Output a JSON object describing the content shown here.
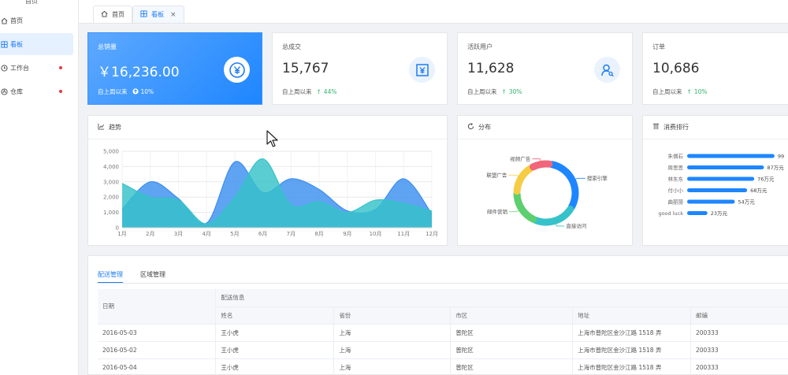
{
  "sidebar": {
    "top_label": "首页",
    "items": [
      {
        "label": "首页",
        "icon": "home-icon",
        "active": false,
        "dot": false
      },
      {
        "label": "看板",
        "icon": "grid-icon",
        "active": true,
        "dot": false
      },
      {
        "label": "工作台",
        "icon": "clock-icon",
        "active": false,
        "dot": true
      },
      {
        "label": "仓库",
        "icon": "box-icon",
        "active": false,
        "dot": true
      }
    ]
  },
  "tabs": [
    {
      "label": "首页",
      "icon": "home-icon",
      "active": false
    },
    {
      "label": "看板",
      "icon": "grid-icon",
      "active": true,
      "close": "×"
    }
  ],
  "stats": [
    {
      "title": "总销量",
      "value": "￥16,236.00",
      "foot": "自上周以来",
      "pct": "10%",
      "icon": "yen-coin-icon",
      "primary": true
    },
    {
      "title": "总成交",
      "value": "15,767",
      "foot": "自上周以来",
      "pct": "44%",
      "icon": "yen-bill-icon",
      "primary": false
    },
    {
      "title": "活跃用户",
      "value": "11,628",
      "foot": "自上周以来",
      "pct": "30%",
      "icon": "user-search-icon",
      "primary": false
    },
    {
      "title": "订单",
      "value": "10,686",
      "foot": "自上周以来",
      "pct": "10%",
      "icon": "order-icon",
      "primary": false
    }
  ],
  "panels": {
    "trend": "趋势",
    "distribution": "分布",
    "ranking": "消费排行"
  },
  "colors": {
    "primary": "#1e86ff",
    "teal": "#3cc4c4",
    "up": "#2fb56a"
  },
  "chart_data": [
    {
      "type": "area",
      "categories": [
        "1月",
        "2月",
        "3月",
        "4月",
        "5月",
        "6月",
        "7月",
        "8月",
        "9月",
        "10月",
        "11月",
        "12月"
      ],
      "ylim": [
        0,
        5000
      ],
      "yticks": [
        "0",
        "1,000",
        "2,000",
        "3,000",
        "4,000",
        "5,000"
      ],
      "grid": true,
      "series": [
        {
          "values": [
            1200,
            3000,
            1900,
            300,
            4300,
            2300,
            3200,
            2500,
            1100,
            1200,
            3200,
            900
          ],
          "color": "#3c8ff0"
        },
        {
          "values": [
            2900,
            2000,
            1800,
            250,
            2000,
            4500,
            1500,
            1700,
            1000,
            1800,
            1600,
            1100
          ],
          "color": "#36c2c9"
        }
      ]
    },
    {
      "type": "pie",
      "donut": true,
      "slices": [
        {
          "name": "搜索引擎",
          "value": 30,
          "color": "#1e86ff"
        },
        {
          "name": "直接访问",
          "value": 22,
          "color": "#36c2c9"
        },
        {
          "name": "邮件营销",
          "value": 18,
          "color": "#5ccf6e"
        },
        {
          "name": "联盟广告",
          "value": 16,
          "color": "#f5cd45"
        },
        {
          "name": "视频广告",
          "value": 10,
          "color": "#f0667a"
        }
      ]
    },
    {
      "type": "bar",
      "orientation": "horizontal",
      "xlim": [
        0,
        100
      ],
      "categories": [
        "朱偶石",
        "周思思",
        "林东东",
        "付小小",
        "曲丽丽",
        "good luck"
      ],
      "values": [
        99,
        87,
        76,
        68,
        54,
        23
      ],
      "labels": [
        "99",
        "87万元",
        "76万元",
        "68万元",
        "54万元",
        "23万元"
      ],
      "color": "#1e86ff"
    }
  ],
  "table": {
    "tabs": [
      "配送管理",
      "区域管理"
    ],
    "date_header": "日期",
    "group_header": "配送信息",
    "columns": [
      "姓名",
      "省份",
      "市区",
      "地址",
      "邮编"
    ],
    "rows": [
      [
        "2016-05-03",
        "王小虎",
        "上海",
        "普陀区",
        "上海市普陀区金沙江路 1518 弄",
        "200333"
      ],
      [
        "2016-05-02",
        "王小虎",
        "上海",
        "普陀区",
        "上海市普陀区金沙江路 1518 弄",
        "200333"
      ],
      [
        "2016-05-04",
        "王小虎",
        "上海",
        "普陀区",
        "上海市普陀区金沙江路 1518 弄",
        "200333"
      ]
    ]
  }
}
